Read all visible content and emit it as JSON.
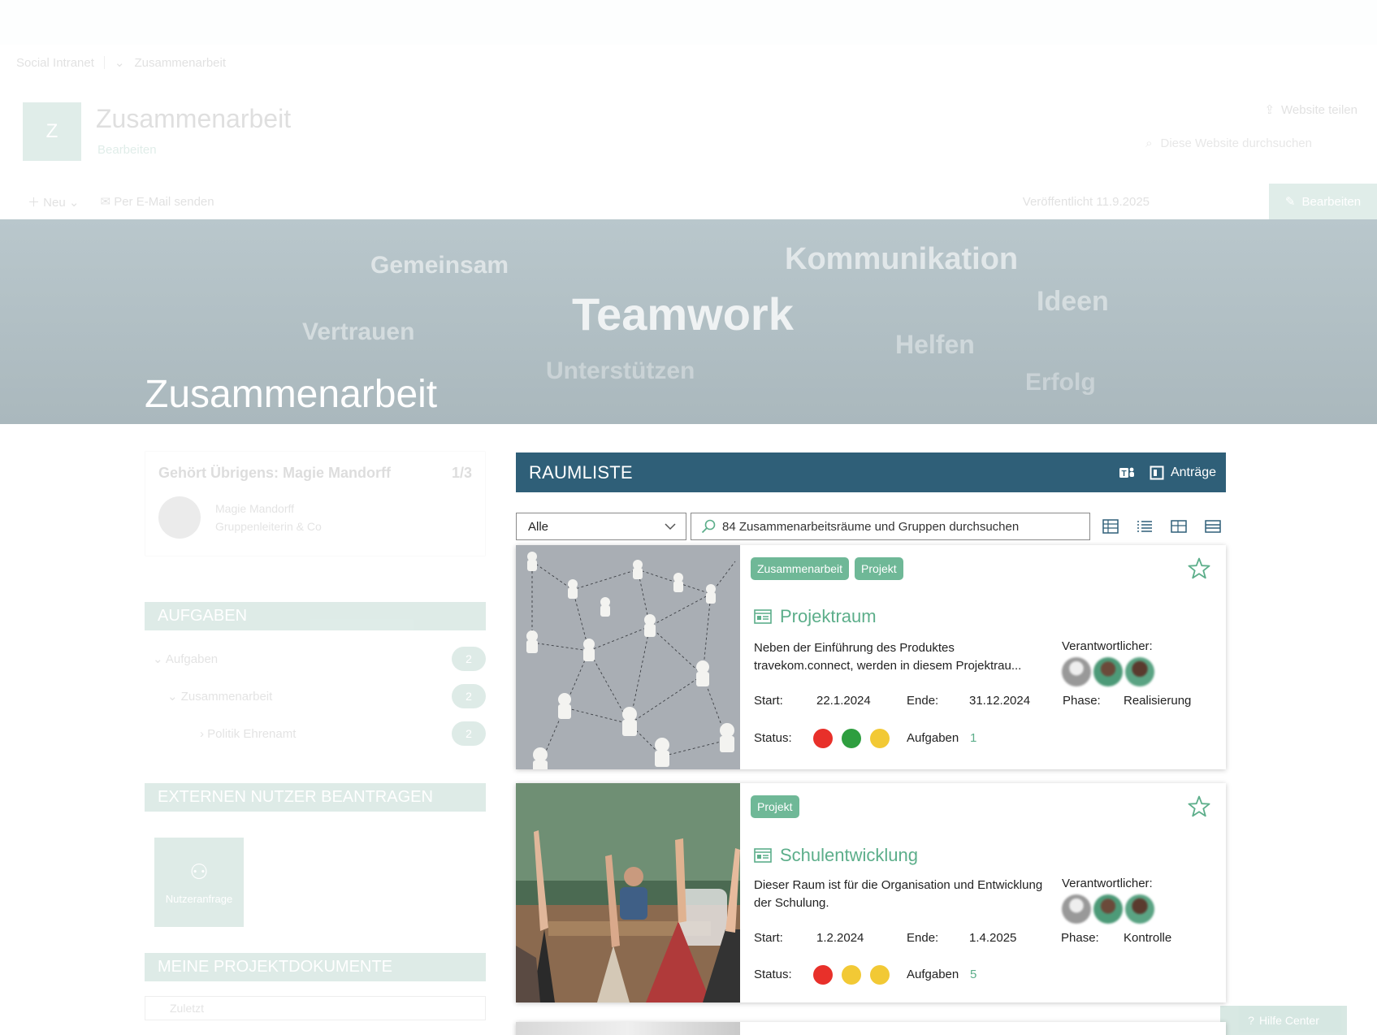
{
  "chrome": {
    "breadcrumb": [
      "Social Intranet",
      "Zusammenarbeit"
    ],
    "site_logo_letter": "Z",
    "site_title": "Zusammenarbeit",
    "site_subtitle": "Bearbeiten",
    "share_label": "Website teilen",
    "search_placeholder": "Diese Website durchsuchen",
    "cmd_new": "Neu",
    "cmd_email": "Per E-Mail senden",
    "published": "Veröffentlicht 11.9.2025",
    "edit_button": "Bearbeiten"
  },
  "hero": {
    "words": [
      "Gemeinsam",
      "Kommunikation",
      "Ideen",
      "Teamwork",
      "Vertrauen",
      "Helfen",
      "Unterstützen",
      "Erfolg"
    ],
    "title": "Zusammenarbeit"
  },
  "left": {
    "person_heading": "Gehört Übrigens: Magie Mandorff",
    "person_count": "1/3",
    "person_name": "Magie Mandorff",
    "person_role": "Gruppenleiterin & Co",
    "tasks_head": "AUFGABEN",
    "tree": [
      {
        "label": "Aufgaben",
        "count": "2"
      },
      {
        "label": "Zusammenarbeit",
        "count": "2"
      },
      {
        "label": "Politik Ehrenamt",
        "count": "2"
      }
    ],
    "external_head": "EXTERNEN NUTZER BEANTRAGEN",
    "tile_label": "Nutzeranfrage",
    "docs_head": "MEINE PROJEKTDOKUMENTE",
    "docs_first": "Zuletzt"
  },
  "raumliste": {
    "title": "RAUMLISTE",
    "antraege": "Anträge",
    "filter_value": "Alle",
    "search_placeholder": "84 Zusammenarbeitsräume und Gruppen durchsuchen"
  },
  "rooms": [
    {
      "tags": [
        "Zusammenarbeit",
        "Projekt"
      ],
      "title": "Projektraum",
      "description": "Neben der Einführung des Produktes travekom.connect, werden in diesem Projektrau...",
      "responsible_label": "Verantwortlicher:",
      "start_label": "Start:",
      "start": "22.1.2024",
      "end_label": "Ende:",
      "end": "31.12.2024",
      "phase_label": "Phase:",
      "phase": "Realisierung",
      "status_label": "Status:",
      "status_colors": [
        "#e8302a",
        "#2e9e3f",
        "#f2c935"
      ],
      "tasks_label": "Aufgaben",
      "tasks": "1"
    },
    {
      "tags": [
        "Projekt"
      ],
      "title": "Schulentwicklung",
      "description": "Dieser Raum ist für die Organisation und Entwicklung der Schulung.",
      "responsible_label": "Verantwortlicher:",
      "start_label": "Start:",
      "start": "1.2.2024",
      "end_label": "Ende:",
      "end": "1.4.2025",
      "phase_label": "Phase:",
      "phase": "Kontrolle",
      "status_label": "Status:",
      "status_colors": [
        "#e8302a",
        "#f2c935",
        "#f2c935"
      ],
      "tasks_label": "Aufgaben",
      "tasks": "5"
    }
  ],
  "help_center": "Hilfe Center",
  "colors": {
    "header": "#2f5f78",
    "accent": "#5cae8a",
    "tag": "#6fb897"
  }
}
